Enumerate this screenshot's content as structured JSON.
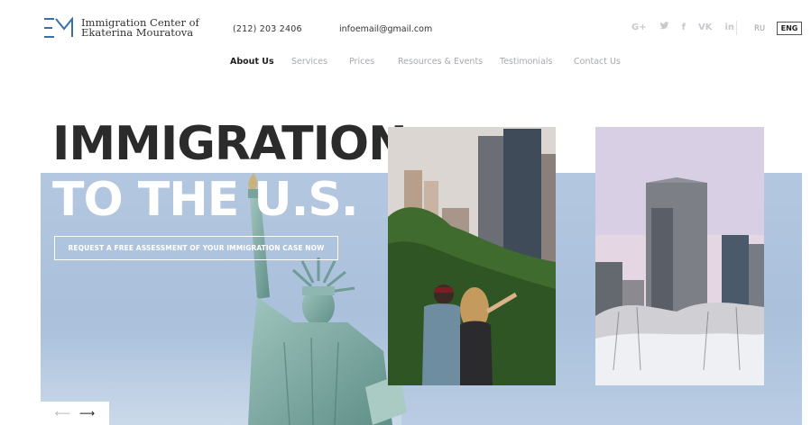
{
  "brand": {
    "name_line1": "Immigration Center of",
    "name_line2": "Ekaterina Mouratova"
  },
  "contact": {
    "phone": "(212) 203 2406",
    "email": "infoemail@gmail.com"
  },
  "social": [
    {
      "icon": "google-plus-icon",
      "glyph": "G+"
    },
    {
      "icon": "twitter-icon",
      "glyph": "🐦"
    },
    {
      "icon": "facebook-icon",
      "glyph": "f"
    },
    {
      "icon": "vk-icon",
      "glyph": "VK"
    },
    {
      "icon": "linkedin-icon",
      "glyph": "in"
    }
  ],
  "languages": {
    "ru": "RU",
    "eng": "ENG",
    "active": "ENG"
  },
  "nav": {
    "items": [
      "About Us",
      "Services",
      "Prices",
      "Resources & Events",
      "Testimonials",
      "Contact Us"
    ],
    "active": "About Us"
  },
  "hero": {
    "title_line1": "IMMIGRATION",
    "title_line2": "TO THE U.S.",
    "cta_label": "REQUEST A FREE ASSESSMENT OF YOUR IMMIGRATION CASE NOW"
  },
  "slider": {
    "prev_glyph": "⟵",
    "next_glyph": "⟶"
  },
  "colors": {
    "hero_bg": "#b4c7e0",
    "title_dark": "#2b2b2b",
    "nav_inactive": "#a6a9b0"
  }
}
